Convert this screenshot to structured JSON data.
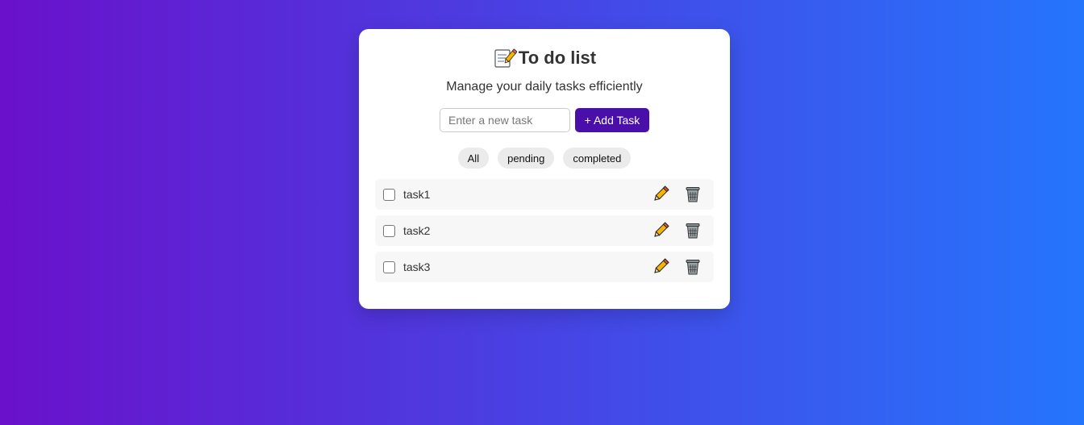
{
  "app": {
    "title": "To do list",
    "title_icon": "memo-icon",
    "subtitle": "Manage your daily tasks efficiently"
  },
  "add_task": {
    "input_value": "",
    "placeholder": "Enter a new task",
    "button_label": "+ Add Task"
  },
  "filters": {
    "all": "All",
    "pending": "pending",
    "completed": "completed"
  },
  "tasks": [
    {
      "text": "task1",
      "completed": false
    },
    {
      "text": "task2",
      "completed": false
    },
    {
      "text": "task3",
      "completed": false
    }
  ],
  "icons": {
    "edit": "pencil-icon",
    "delete": "trash-icon"
  },
  "colors": {
    "gradient_start": "#6a11cb",
    "gradient_end": "#2575fc",
    "accent": "#4a0fa8"
  }
}
